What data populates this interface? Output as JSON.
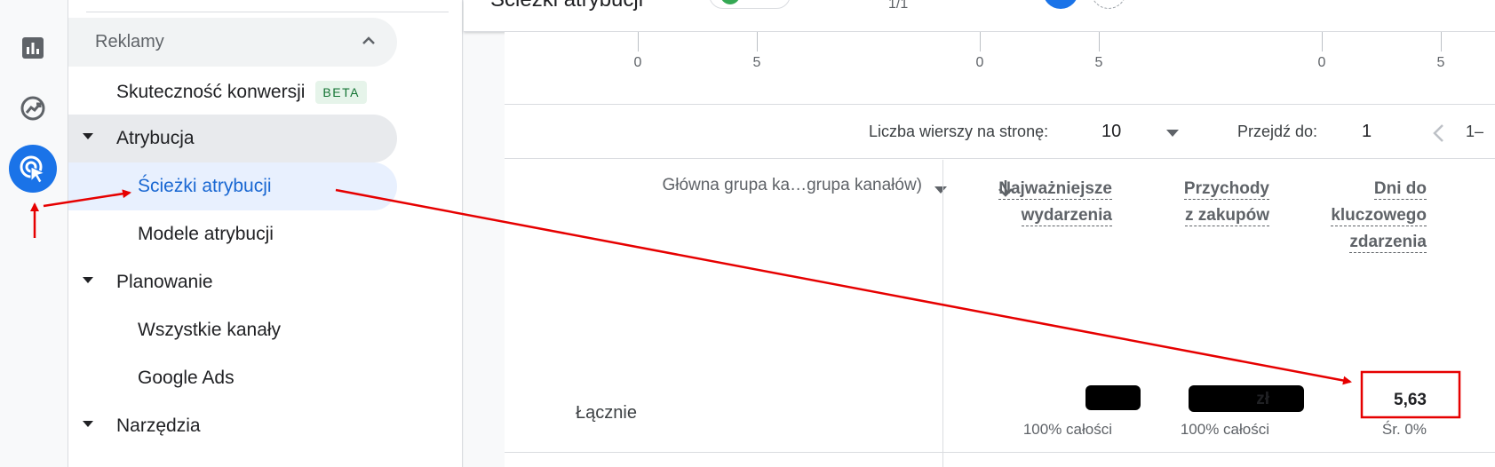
{
  "rail": {
    "icons": [
      "grid-icon",
      "bar-chart-icon",
      "insights-icon",
      "ads-cursor-icon"
    ]
  },
  "nav": {
    "section_label": "Reklamy",
    "items": {
      "skutecznosc": "Skuteczność konwersji",
      "beta": "BETA",
      "atrybucja": "Atrybucja",
      "sciezki": "Ścieżki atrybucji",
      "modele": "Modele atrybucji",
      "planowanie": "Planowanie",
      "wszystkie": "Wszystkie kanały",
      "google_ads": "Google Ads",
      "narzedzia": "Narzędzia"
    }
  },
  "topbar": {
    "title": "Ścieżki atrybucji",
    "fraction": "1/1"
  },
  "axis": {
    "ticks": [
      "0",
      "5",
      "0",
      "5",
      "0",
      "5"
    ]
  },
  "pager": {
    "rows_label": "Liczba wierszy na stronę:",
    "rows_value": "10",
    "goto_label": "Przejdź do:",
    "goto_value": "1",
    "range": "1–"
  },
  "table": {
    "dimension_header": "Główna grupa ka…grupa kanałów)",
    "columns": [
      {
        "line1": "Najważniejsze",
        "line2": "wydarzenia"
      },
      {
        "line1": "Przychody",
        "line2": "z zakupów"
      },
      {
        "line1": "Dni do",
        "line2": "kluczowego",
        "line3": "zdarzenia"
      }
    ],
    "total_row": {
      "label": "Łącznie",
      "revenue_suffix": "zł",
      "days_value": "5,63",
      "events_share": "100% całości",
      "revenue_share": "100% całości",
      "days_avg": "Śr. 0%"
    }
  },
  "colors": {
    "accent": "#1a73e8",
    "annotation": "#e60000"
  }
}
